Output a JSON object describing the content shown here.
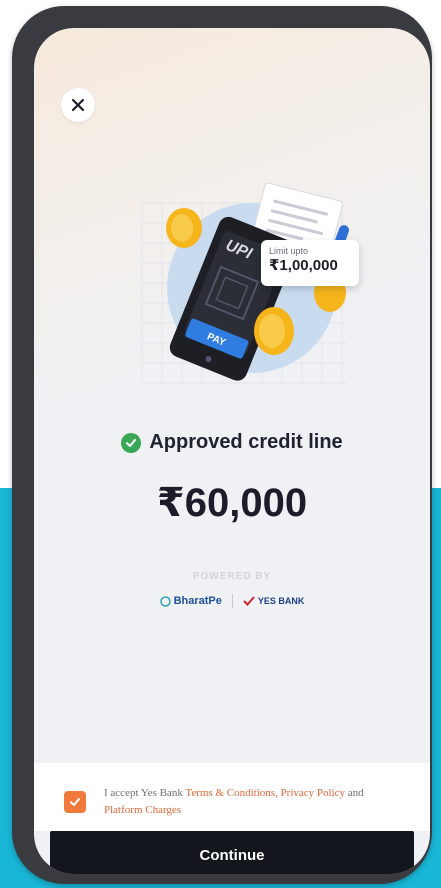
{
  "close": {
    "icon": "close-icon"
  },
  "illustration": {
    "upi_text": "UPI",
    "pay_text": "PAY",
    "limit_caption": "Limit upto",
    "limit_value": "₹1,00,000"
  },
  "status": {
    "approved_text": "Approved credit line",
    "amount": "₹60,000"
  },
  "partners": {
    "powered_by": "POWERED BY",
    "bharatpe": "BharatPe",
    "yesbank": "YES BANK"
  },
  "consent": {
    "checked": true,
    "prefix": "I accept Yes Bank ",
    "terms_link": "Terms & Conditions, Privacy Policy",
    "middle": " and ",
    "charges_link": "Platform Charges"
  },
  "cta": {
    "continue_label": "Continue"
  },
  "colors": {
    "accent": "#f07a3c",
    "success": "#3aa757",
    "cta_bg": "#14161d",
    "backdrop": "#19b6d6"
  }
}
